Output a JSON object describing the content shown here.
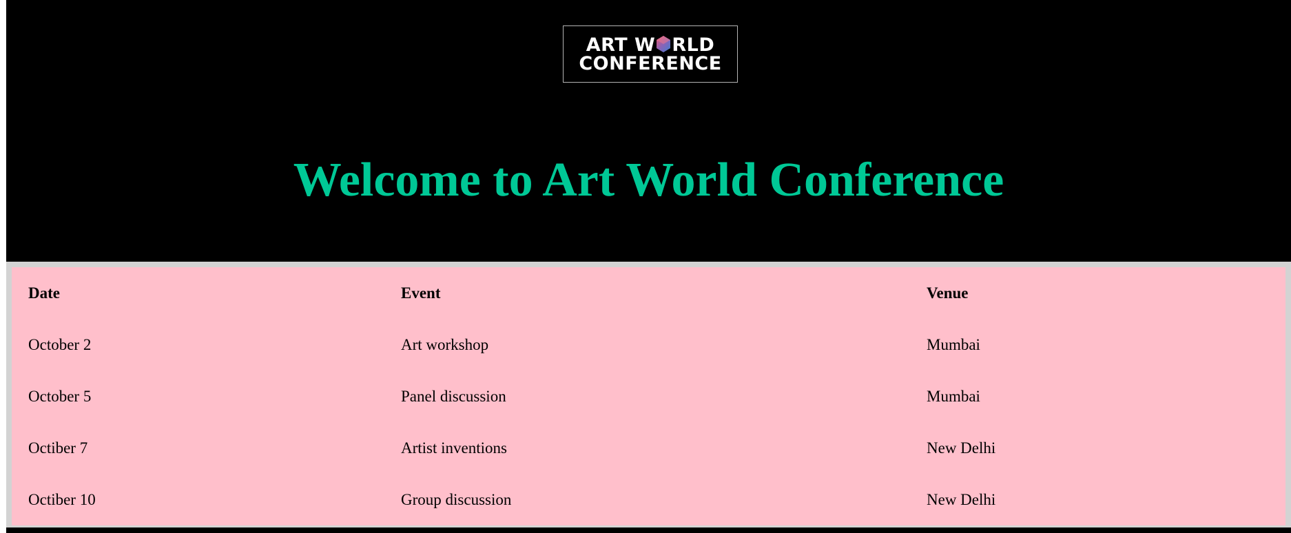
{
  "logo": {
    "line1_before": "ART W",
    "line1_after": "RLD",
    "line2": "CONFERENCE",
    "gem_icon": "gem-hexagon-icon",
    "gem_colors": [
      "#e8546f",
      "#8a63b8",
      "#3f7fd0"
    ]
  },
  "header": {
    "title": "Welcome to Art World Conference"
  },
  "colors": {
    "header_bg": "#000000",
    "title": "#00c896",
    "table_bg": "#ffbfcb",
    "table_frame": "#d3d3d3"
  },
  "schedule": {
    "columns": [
      "Date",
      "Event",
      "Venue"
    ],
    "rows": [
      [
        "October 2",
        "Art workshop",
        "Mumbai"
      ],
      [
        "October 5",
        "Panel discussion",
        "Mumbai"
      ],
      [
        "Octiber 7",
        "Artist inventions",
        "New Delhi"
      ],
      [
        "Octiber 10",
        "Group discussion",
        "New Delhi"
      ]
    ]
  }
}
